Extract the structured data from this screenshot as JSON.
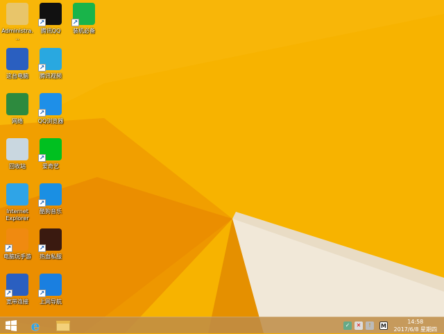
{
  "desktop": {
    "icons": [
      {
        "label": "Administra...",
        "icon": "user-folder-icon",
        "color": "#e8c56a",
        "shortcut": false
      },
      {
        "label": "腾讯QQ",
        "icon": "qq-penguin-icon",
        "color": "#111111",
        "shortcut": true
      },
      {
        "label": "装机必备",
        "icon": "shopping-bag-icon",
        "color": "#19b44a",
        "shortcut": true
      },
      {
        "label": "这台电脑",
        "icon": "computer-icon",
        "color": "#2a5fc0",
        "shortcut": false
      },
      {
        "label": "腾讯视频",
        "icon": "tencent-video-icon",
        "color": "#29a8e0",
        "shortcut": true
      },
      {
        "label": "网络",
        "icon": "network-globe-icon",
        "color": "#2d8a3e",
        "shortcut": false
      },
      {
        "label": "QQ浏览器",
        "icon": "qq-browser-icon",
        "color": "#1e8fe8",
        "shortcut": true
      },
      {
        "label": "回收站",
        "icon": "recycle-bin-icon",
        "color": "#c9d7e0",
        "shortcut": false
      },
      {
        "label": "爱奇艺",
        "icon": "iqiyi-icon",
        "color": "#00c020",
        "shortcut": true
      },
      {
        "label": "Internet Explorer",
        "icon": "internet-explorer-icon",
        "color": "#2fa4e7",
        "shortcut": false
      },
      {
        "label": "酷狗音乐",
        "icon": "kugou-icon",
        "color": "#1a8fe3",
        "shortcut": true
      },
      {
        "label": "电脑玩手游",
        "icon": "game-mascot-icon",
        "color": "#f08a10",
        "shortcut": true
      },
      {
        "label": "热血私服",
        "icon": "game-hot-icon",
        "color": "#3a1a10",
        "shortcut": true
      },
      {
        "label": "宽带连接",
        "icon": "broadband-connection-icon",
        "color": "#2a5fc0",
        "shortcut": true
      },
      {
        "label": "上网导航",
        "icon": "browser-e-icon",
        "color": "#1a7fe0",
        "shortcut": true
      }
    ]
  },
  "taskbar": {
    "start": "windows-start-icon",
    "pinned": [
      "internet-explorer-icon",
      "file-explorer-icon"
    ],
    "tray": [
      "network-ok-icon",
      "volume-muted-icon",
      "wifi-warning-icon",
      "input-method-icon"
    ],
    "ime_label": "M",
    "time": "14:58",
    "date": "2017/6/8 星期四"
  }
}
